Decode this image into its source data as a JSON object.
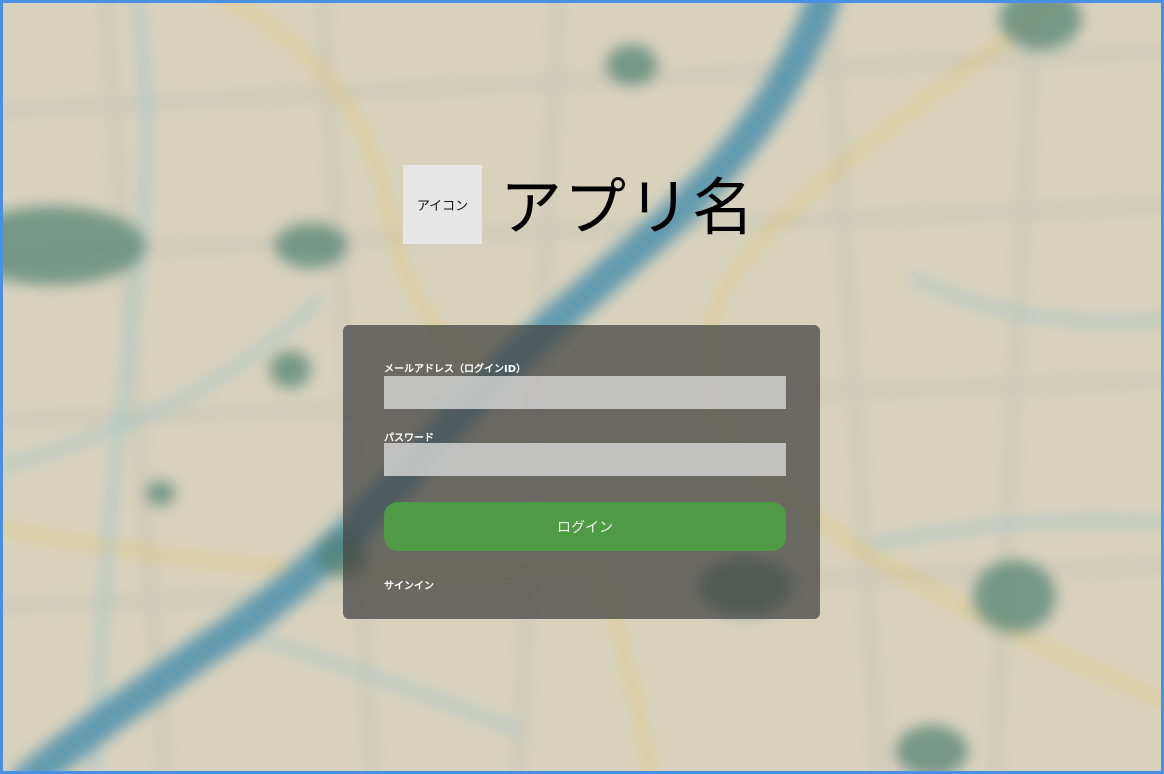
{
  "brand": {
    "icon_placeholder": "アイコン",
    "app_name": "アプリ名"
  },
  "login_form": {
    "email_label": "メールアドレス（ログインID）",
    "email_value": "",
    "password_label": "パスワード",
    "password_value": "",
    "login_button": "ログイン",
    "signin_link": "サインイン"
  },
  "colors": {
    "frame_border": "#4a90e2",
    "login_button": "#4f9a45",
    "panel": "#464644"
  }
}
